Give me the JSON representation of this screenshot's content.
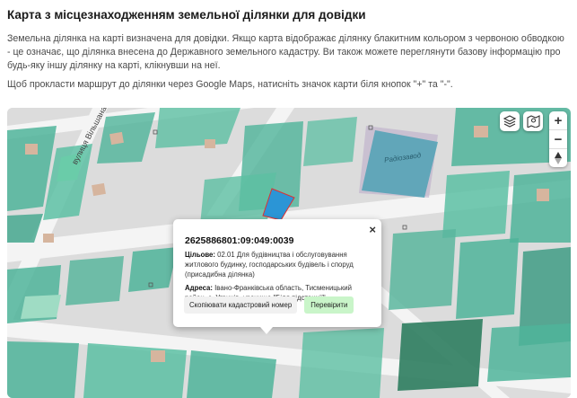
{
  "page": {
    "title": "Карта з місцезнаходженням земельної ділянки для довідки",
    "intro": "Земельна ділянка на карті визначена для довідки. Якщо карта відображає ділянку блакитним кольором з червоною обводкою - це означає, що ділянка внесена до Державного земельного кадастру. Ви також можете переглянути базову інформацію про будь-яку іншу ділянку на карті, клікнувши на неї.",
    "route_hint": "Щоб прокласти маршрут до ділянки через Google Maps, натисніть значок карти біля кнопок \"+\" та \"-\"."
  },
  "map": {
    "street_label": "вулиця Вільшана",
    "place_label": "Радіозавод",
    "controls": {
      "layers_icon": "layers-icon",
      "route_icon": "map-route-icon",
      "zoom_in": "+",
      "zoom_out": "−",
      "compass_icon": "compass-icon"
    },
    "colors": {
      "parcel_fill": "#4fb49a",
      "selected_parcel": "#2b95d6",
      "road": "#f4f4f4",
      "background": "#dcdcdc",
      "building": "#d6b59e"
    }
  },
  "popup": {
    "cadastral_number": "2625886801:09:049:0039",
    "purpose_label": "Цільове:",
    "purpose_value": "02.01 Для будівництва і обслуговування житлового будинку, господарських будівель і споруд (присадибна ділянка)",
    "address_label": "Адреса:",
    "address_value": "Івано-Франківська область, Тисменицький район, с. Угринів, урочище \"Біля підстанції\"",
    "copy_button": "Скопіювати кадастровий номер",
    "check_button": "Перевірити",
    "close_label": "×"
  }
}
